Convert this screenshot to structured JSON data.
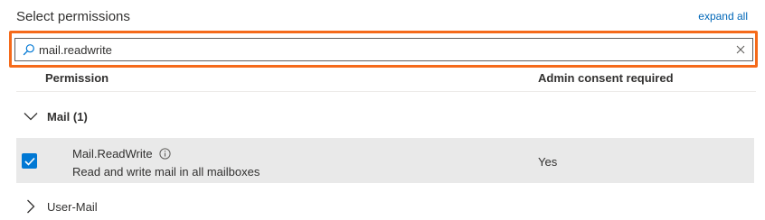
{
  "header": {
    "title": "Select permissions",
    "expand_all": "expand all"
  },
  "search": {
    "value": "mail.readwrite",
    "icon": "search-icon",
    "clear_icon": "close-icon"
  },
  "columns": {
    "permission": "Permission",
    "admin_consent": "Admin consent required"
  },
  "groups": [
    {
      "label": "Mail (1)",
      "expanded": true,
      "permissions": [
        {
          "name": "Mail.ReadWrite",
          "description": "Read and write mail in all mailboxes",
          "admin_consent": "Yes",
          "checked": true
        }
      ]
    },
    {
      "label": "User-Mail",
      "expanded": false
    }
  ],
  "colors": {
    "accent": "#0078d4",
    "highlight": "#f56a1a",
    "link": "#0067b8",
    "selected_row": "#e9e9e9"
  }
}
